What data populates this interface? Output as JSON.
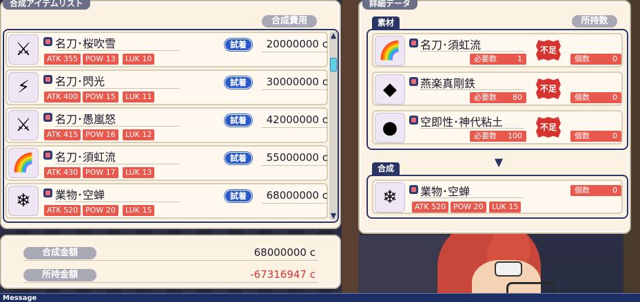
{
  "left_panel": {
    "title": "合成アイテムリスト",
    "cost_header": "合成費用"
  },
  "item_list": [
    {
      "icon": "katana-icon",
      "glyph": "⚔",
      "name": "名刀･桜吹雪",
      "stats": [
        {
          "label": "ATK",
          "value": "355"
        },
        {
          "label": "POW",
          "value": "13"
        },
        {
          "label": "LUK",
          "value": "10"
        }
      ],
      "try_label": "試着",
      "price": "20000000 c"
    },
    {
      "icon": "katana-icon",
      "glyph": "⚡",
      "name": "名刀･閃光",
      "stats": [
        {
          "label": "ATK",
          "value": "400"
        },
        {
          "label": "POW",
          "value": "15"
        },
        {
          "label": "LUK",
          "value": "11"
        }
      ],
      "try_label": "試着",
      "price": "30000000 c"
    },
    {
      "icon": "katana-icon",
      "glyph": "⚔",
      "name": "名刀･愚嵐怒",
      "stats": [
        {
          "label": "ATK",
          "value": "415"
        },
        {
          "label": "POW",
          "value": "16"
        },
        {
          "label": "LUK",
          "value": "12"
        }
      ],
      "try_label": "試着",
      "price": "42000000 c"
    },
    {
      "icon": "katana-icon",
      "glyph": "🌈",
      "name": "名刀･須虹流",
      "stats": [
        {
          "label": "ATK",
          "value": "430"
        },
        {
          "label": "POW",
          "value": "17"
        },
        {
          "label": "LUK",
          "value": "13"
        }
      ],
      "try_label": "試着",
      "price": "55000000 c"
    },
    {
      "icon": "katana-icon",
      "glyph": "❄",
      "name": "業物･空蝉",
      "stats": [
        {
          "label": "ATK",
          "value": "520"
        },
        {
          "label": "POW",
          "value": "20"
        },
        {
          "label": "LUK",
          "value": "15"
        }
      ],
      "try_label": "試着",
      "price": "68000000 c"
    }
  ],
  "totals": {
    "cost_label": "合成金額",
    "cost_value": "68000000 c",
    "owned_label": "所持金額",
    "owned_value": "-67316947 c",
    "owned_color": "#d8342f"
  },
  "detail_panel": {
    "title": "詳細データ",
    "owned_header": "所持数",
    "materials_tag": "素材",
    "result_tag": "合成",
    "materials": [
      {
        "icon": "rainbow-katana-icon",
        "glyph": "🌈",
        "name": "名刀･須虹流",
        "need_label": "必要数",
        "need_value": "1",
        "lack": "不足",
        "own_label": "個数",
        "own_value": "0"
      },
      {
        "icon": "blue-ore-icon",
        "glyph": "◆",
        "name": "燕楽真剛鉄",
        "need_label": "必要数",
        "need_value": "80",
        "lack": "不足",
        "own_label": "個数",
        "own_value": "0"
      },
      {
        "icon": "blue-clay-icon",
        "glyph": "●",
        "name": "空即性･神代粘土",
        "need_label": "必要数",
        "need_value": "100",
        "lack": "不足",
        "own_label": "個数",
        "own_value": "0"
      }
    ],
    "result": {
      "icon": "katana-icon",
      "glyph": "❄",
      "name": "業物･空蝉",
      "stats": [
        {
          "label": "ATK",
          "value": "520"
        },
        {
          "label": "POW",
          "value": "20"
        },
        {
          "label": "LUK",
          "value": "15"
        }
      ],
      "own_label": "個数",
      "own_value": "0"
    }
  },
  "message_bar": {
    "label": "Message"
  }
}
